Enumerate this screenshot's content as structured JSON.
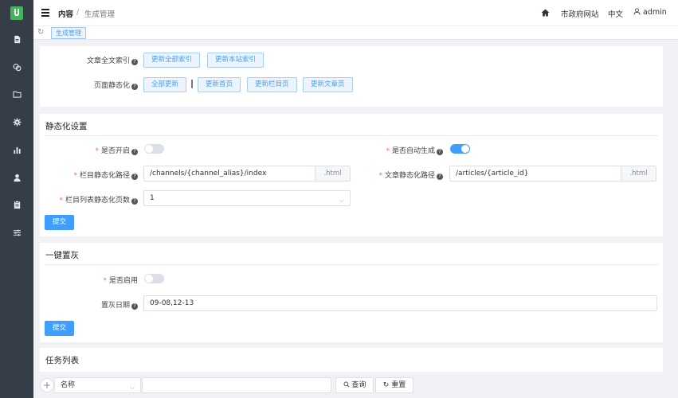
{
  "sidebar": {
    "logo_text": "U",
    "logo_color": "#47b25e",
    "background": "#353d49",
    "items": [
      {
        "icon": "document-icon"
      },
      {
        "icon": "chat-icon"
      },
      {
        "icon": "folder-icon"
      },
      {
        "icon": "gear-icon"
      },
      {
        "icon": "bar-chart-icon"
      },
      {
        "icon": "user-icon"
      },
      {
        "icon": "clipboard-icon"
      },
      {
        "icon": "sliders-icon"
      }
    ]
  },
  "header": {
    "breadcrumb_root": "内容",
    "breadcrumb_sep": "/",
    "breadcrumb_current": "生成管理",
    "site_name": "市政府网站",
    "language": "中文",
    "user": "admin"
  },
  "tabs": {
    "active": "生成管理"
  },
  "index_card": {
    "fulltext_label": "文章全文索引",
    "update_all_index": "更新全部索引",
    "update_site_index": "更新本站索引",
    "static_label": "页面静态化",
    "update_all": "全部更新",
    "separator": "|",
    "update_home": "更新首页",
    "update_channels": "更新栏目页",
    "update_articles": "更新文章页"
  },
  "static_settings": {
    "title": "静态化设置",
    "enabled_label": "是否开启",
    "enabled": false,
    "auto_generate_label": "是否自动生成",
    "auto_generate": true,
    "channel_path_label": "栏目静态化路径",
    "channel_path_value": "/channels/{channel_alias}/index",
    "channel_path_suffix": ".html",
    "article_path_label": "文章静态化路径",
    "article_path_value": "/articles/{article_id}",
    "article_path_suffix": ".html",
    "list_pages_label": "栏目列表静态化页数",
    "list_pages_value": "1",
    "submit": "提交"
  },
  "gray_card": {
    "title": "一键置灰",
    "enabled_label": "是否启用",
    "enabled": false,
    "date_label": "置灰日期",
    "date_value": "09-08,12-13",
    "submit": "提交"
  },
  "task_card": {
    "title": "任务列表"
  },
  "task_toolbar": {
    "field_select": "名称",
    "search_value": "",
    "query": "查询",
    "reset": "重置"
  },
  "colors": {
    "primary": "#409eff",
    "switch_off": "#dcdfe6",
    "required": "#f56c6c"
  }
}
